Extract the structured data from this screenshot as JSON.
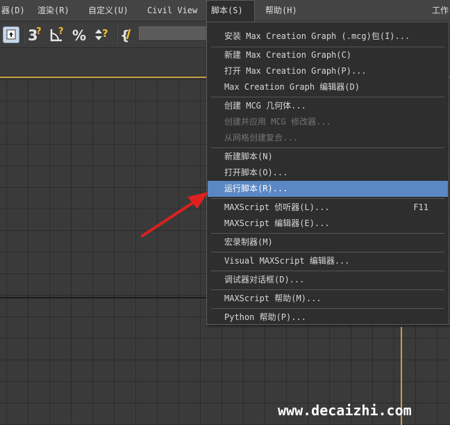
{
  "menubar": {
    "items": [
      {
        "label": "器(D)"
      },
      {
        "label": "渲染(R)"
      },
      {
        "label": "自定义(U)"
      },
      {
        "label": "Civil View"
      },
      {
        "label": "脚本(S)"
      },
      {
        "label": "帮助(H)"
      },
      {
        "label": "工作"
      }
    ]
  },
  "toolbar": {
    "icons": [
      "select-filter-icon",
      "snap-3d-icon",
      "angle-snap-icon",
      "percent-snap-icon",
      "spinner-snap-icon",
      "named-selection-icon"
    ]
  },
  "dropdown": {
    "items": [
      {
        "label": "安装 Max Creation Graph (.mcg)包(I)...",
        "state": "normal"
      },
      {
        "label": "新建 Max Creation Graph(C)",
        "state": "normal"
      },
      {
        "label": "打开 Max Creation Graph(P)...",
        "state": "normal"
      },
      {
        "label": "Max Creation Graph  编辑器(D)",
        "state": "normal"
      },
      {
        "label": "创建 MCG 几何体...",
        "state": "normal"
      },
      {
        "label": "创建并应用 MCG 修改器...",
        "state": "disabled"
      },
      {
        "label": "从网格创建复合...",
        "state": "disabled"
      },
      {
        "label": "新建脚本(N)",
        "state": "normal"
      },
      {
        "label": "打开脚本(O)...",
        "state": "normal"
      },
      {
        "label": "运行脚本(R)...",
        "state": "highlighted"
      },
      {
        "label": "MAXScript 侦听器(L)...",
        "shortcut": "F11",
        "state": "normal"
      },
      {
        "label": "MAXScript 编辑器(E)...",
        "state": "normal"
      },
      {
        "label": "宏录制器(M)",
        "state": "normal"
      },
      {
        "label": "Visual MAXScript 编辑器...",
        "state": "normal"
      },
      {
        "label": "调试器对话框(D)...",
        "state": "normal"
      },
      {
        "label": "MAXScript 帮助(M)...",
        "state": "normal"
      },
      {
        "label": "Python 帮助(P)...",
        "state": "normal"
      }
    ]
  },
  "watermark": {
    "text": "www.decaizhi.com"
  },
  "colors": {
    "highlight": "#5b88c4",
    "arrow": "#e02020",
    "viewport_border": "#c8a44a"
  }
}
